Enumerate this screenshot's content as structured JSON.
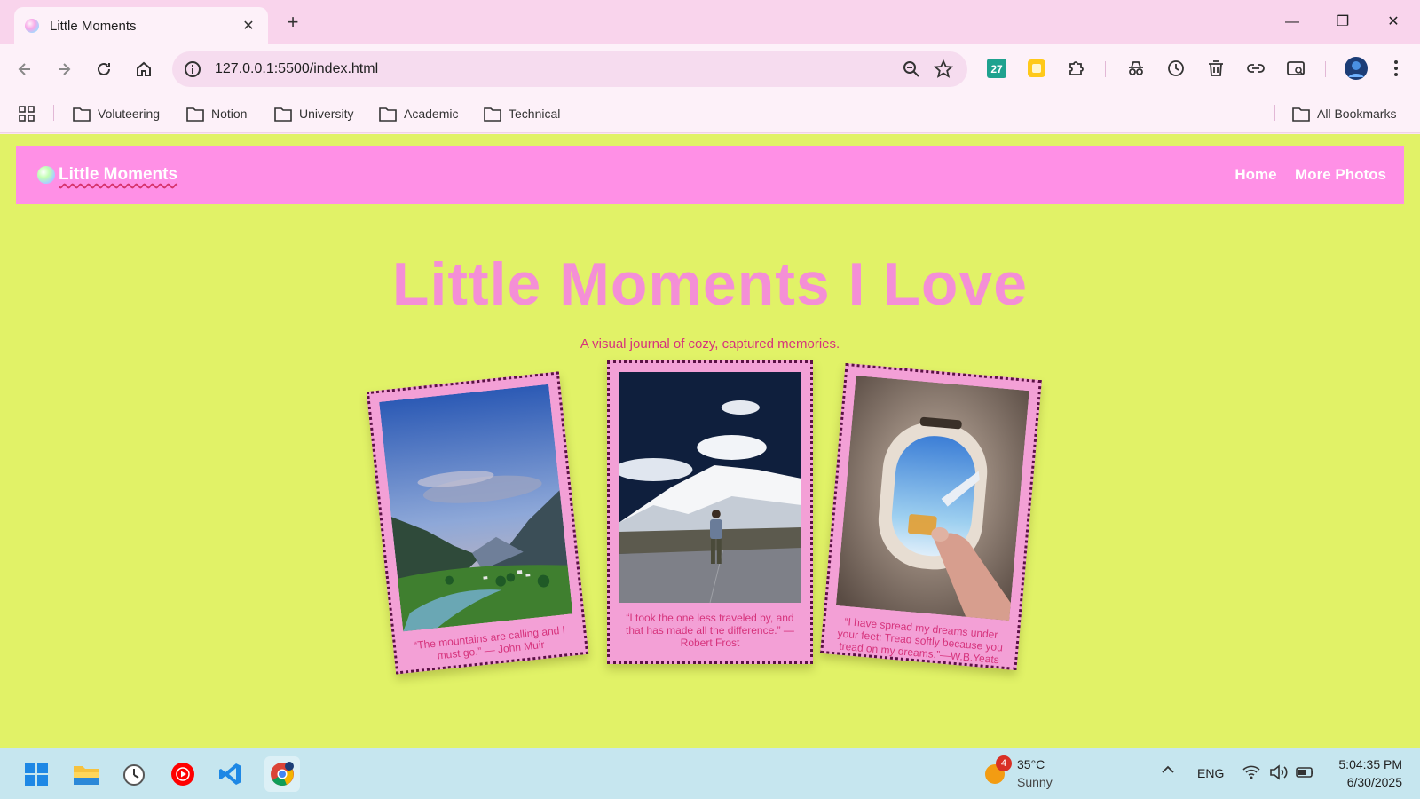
{
  "browser": {
    "tab_title": "Little Moments",
    "new_tab": "+",
    "url": "127.0.0.1:5500/index.html",
    "window": {
      "minimize": "—",
      "restore": "❐",
      "close": "✕"
    }
  },
  "bookmarks": {
    "items": [
      "Voluteering",
      "Notion",
      "University",
      "Academic",
      "Technical"
    ],
    "all": "All Bookmarks"
  },
  "site": {
    "brand": "Little Moments",
    "nav": [
      "Home",
      "More Photos"
    ],
    "title": "Little Moments I Love",
    "subtitle": "A visual journal of cozy, captured memories.",
    "cards": [
      {
        "caption": "“The mountains are calling and I must go.” — John Muir",
        "rotation_deg": -6
      },
      {
        "caption": "“I took the one less traveled by, and that has made all the difference.” — Robert Frost",
        "rotation_deg": 0
      },
      {
        "caption": "“I have spread my dreams under your feet; Tread softly because you tread on my dreams.”—W.B.Yeats",
        "rotation_deg": 5
      }
    ]
  },
  "taskbar": {
    "weather_temp": "35°C",
    "weather_desc": "Sunny",
    "weather_badge": "4",
    "lang": "ENG",
    "time": "5:04:35 PM",
    "date": "6/30/2025"
  },
  "colors": {
    "page_bg": "#e1f267",
    "nav_bg": "#ff90e6",
    "title": "#f48fd6",
    "accent": "#d6337c",
    "card": "#f3a0d6"
  }
}
